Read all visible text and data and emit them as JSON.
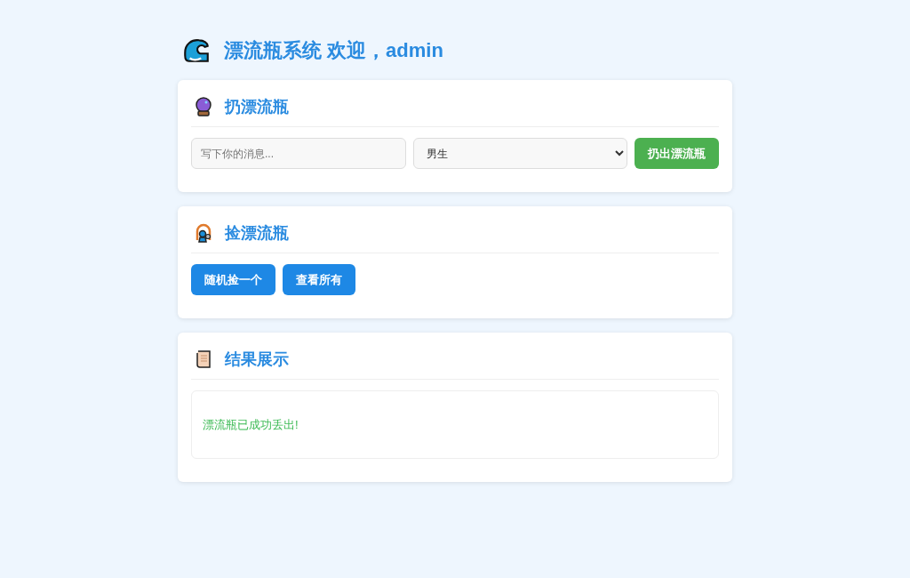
{
  "header": {
    "title": "漂流瓶系统 欢迎，admin"
  },
  "sections": [
    {
      "kind": "throw",
      "title": "扔漂流瓶",
      "message": {
        "placeholder": "写下你的消息..."
      },
      "gender": {
        "value": "男生"
      },
      "button": "扔出漂流瓶"
    },
    {
      "kind": "pick",
      "title": "捡漂流瓶",
      "buttons": [
        "随机捡一个",
        "查看所有"
      ]
    },
    {
      "kind": "result",
      "title": "结果展示",
      "message": "漂流瓶已成功丢出!"
    }
  ]
}
